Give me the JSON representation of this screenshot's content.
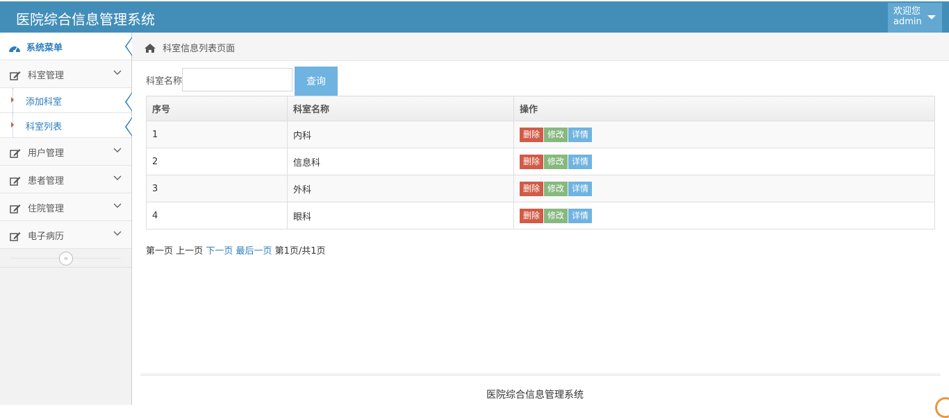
{
  "app": {
    "title": "医院综合信息管理系统"
  },
  "user": {
    "greeting": "欢迎您",
    "name": "admin"
  },
  "sidebar": {
    "header": "系统菜单",
    "groups": [
      {
        "label": "科室管理"
      },
      {
        "label": "用户管理"
      },
      {
        "label": "患者管理"
      },
      {
        "label": "住院管理"
      },
      {
        "label": "电子病历"
      }
    ],
    "sub_items": [
      {
        "label": "添加科室"
      },
      {
        "label": "科室列表"
      }
    ]
  },
  "breadcrumb": {
    "label": "科室信息列表页面"
  },
  "search": {
    "label": "科室名称",
    "value": "",
    "button": "查询"
  },
  "table": {
    "headers": [
      "序号",
      "科室名称",
      "操作"
    ],
    "rows": [
      {
        "id": "1",
        "name": "内科"
      },
      {
        "id": "2",
        "name": "信息科"
      },
      {
        "id": "3",
        "name": "外科"
      },
      {
        "id": "4",
        "name": "眼科"
      }
    ],
    "actions": {
      "delete": "删除",
      "edit": "修改",
      "detail": "详情"
    }
  },
  "pager": {
    "first": "第一页",
    "prev": "上一页",
    "next": "下一页",
    "last": "最后一页",
    "info": "第1页/共1页"
  },
  "footer": {
    "text": "医院综合信息管理系统"
  },
  "colors": {
    "nav": "#438eb9",
    "accent": "#2b7dbc",
    "delete": "#d15b47",
    "edit": "#87b87f",
    "detail": "#6fb3e0"
  }
}
